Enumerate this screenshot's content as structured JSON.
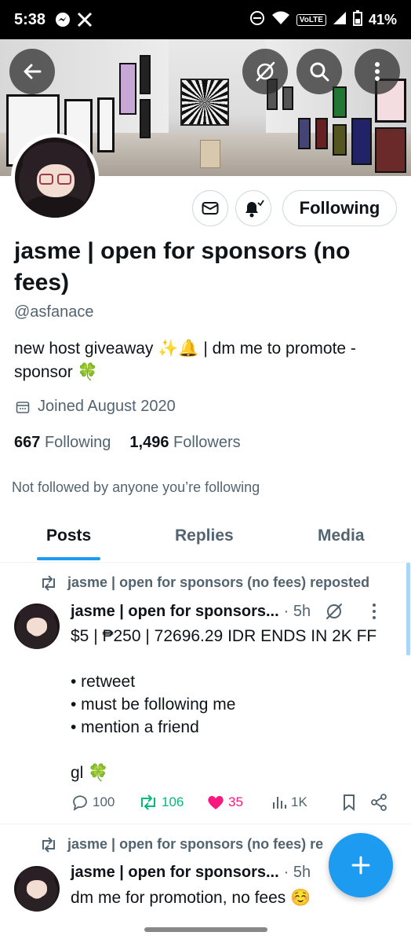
{
  "status_bar": {
    "time": "5:38",
    "battery": "41%",
    "network": "VoLTE"
  },
  "profile": {
    "name": "jasme | open for sponsors (no fees)",
    "handle": "@asfanace",
    "bio": "new host giveaway ✨🔔 | dm me to promote - sponsor 🍀",
    "joined": "Joined August 2020",
    "following_count": "667",
    "following_label": "Following",
    "followers_count": "1,496",
    "followers_label": "Followers",
    "not_followed": "Not followed by anyone you’re following",
    "follow_button": "Following"
  },
  "tabs": [
    {
      "label": "Posts",
      "active": true
    },
    {
      "label": "Replies",
      "active": false
    },
    {
      "label": "Media",
      "active": false
    }
  ],
  "posts": [
    {
      "repost_label": "jasme | open for sponsors (no fees) reposted",
      "author": "jasme | open for sponsors...",
      "time": "· 5h",
      "text": "$5 | ₱250 | 72696.29 IDR ENDS IN 2K FF\n\n• retweet\n• must be following me\n• mention a friend\n\ngl 🍀",
      "replies": "100",
      "reposts": "106",
      "likes": "35",
      "views": "1K"
    },
    {
      "repost_label": "jasme | open for sponsors (no fees) re",
      "author": "jasme | open for sponsors...",
      "time": "· 5h",
      "text": "dm me for promotion, no fees ☺️"
    }
  ],
  "colors": {
    "accent": "#1d9bf0",
    "repost_green": "#00ba7c",
    "like_pink": "#f91880",
    "secondary_text": "#536471"
  }
}
